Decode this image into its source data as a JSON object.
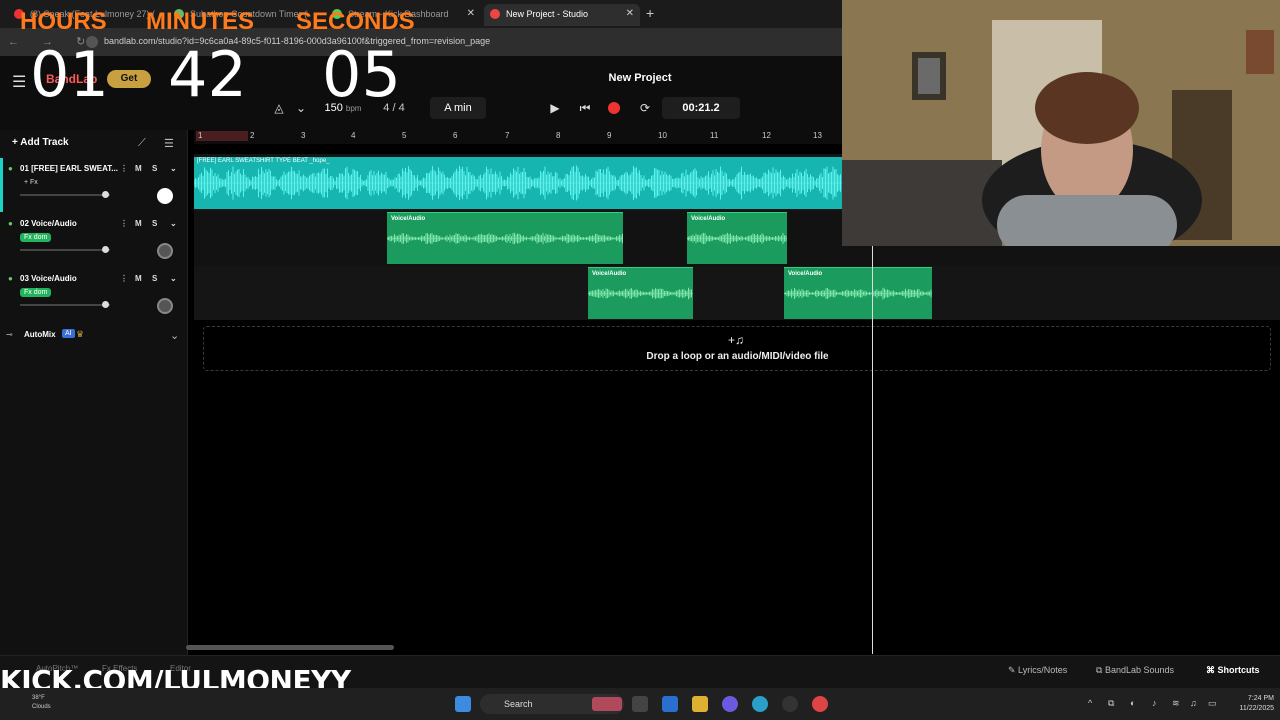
{
  "browser": {
    "tabs": [
      {
        "title": "(8) Speak (Feat Lulmoney 27) (",
        "color": "#e33"
      },
      {
        "title": "Subathon Countdown Timer (L",
        "color": "#6b6"
      },
      {
        "title": "Stream - Kick Dashboard",
        "color": "#5c5"
      },
      {
        "title": "New Project - Studio",
        "color": "#e44"
      }
    ],
    "url": "bandlab.com/studio?id=9c6ca0a4-89c5-f011-8196-000d3a96100f&triggered_from=revision_page"
  },
  "countdown": {
    "hours_label": "HOURS",
    "minutes_label": "MINUTES",
    "seconds_label": "SECONDS",
    "hours": "01",
    "minutes": "42",
    "seconds": "05"
  },
  "header": {
    "logo": "BandLab",
    "get_label": "Get",
    "project_title": "New Project",
    "bpm": "150",
    "bpm_unit": "bpm",
    "time_sig": "4 / 4",
    "key": "A min",
    "time": "00:21.2"
  },
  "tracks_panel": {
    "add_track": "Add Track",
    "tracks": [
      {
        "name": "01  [FREE] EARL SWEAT...",
        "tag": "+ Fx",
        "m": "M",
        "s": "S"
      },
      {
        "name": "02  Voice/Audio",
        "tag": "Fx dom",
        "m": "M",
        "s": "S"
      },
      {
        "name": "03  Voice/Audio",
        "tag": "Fx dom",
        "m": "M",
        "s": "S"
      }
    ],
    "automix": "AutoMix",
    "ai": "AI"
  },
  "timeline": {
    "bars": [
      "1",
      "2",
      "3",
      "4",
      "5",
      "6",
      "7",
      "8",
      "9",
      "10",
      "11",
      "12",
      "13"
    ],
    "clip_main": "[FREE] EARL SWEATSHIRT TYPE BEAT _hope_",
    "clip_voice": "Voice/Audio",
    "drop_text": "Drop a loop or an audio/MIDI/video file"
  },
  "bottom": {
    "lyrics": "Lyrics/Notes",
    "sounds": "BandLab Sounds",
    "shortcuts": "Shortcuts",
    "left1": "AutoPitch™",
    "left2": "Effects",
    "left3": "Editor",
    "kick": "KICK.COM/LULMONEYY"
  },
  "taskbar": {
    "search": "Search",
    "time": "7:24 PM",
    "date": "11/22/2025",
    "weather_temp": "38°F",
    "weather_desc": "Clouds"
  }
}
